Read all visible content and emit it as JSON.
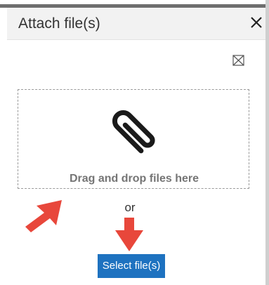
{
  "dialog": {
    "title": "Attach file(s)",
    "close_icon": "close-icon",
    "broken_image_icon": "broken-image-icon"
  },
  "drop_zone": {
    "icon": "paperclip-icon",
    "text": "Drag and drop files here"
  },
  "separator_text": "or",
  "select_button": {
    "label": "Select file(s)",
    "color": "#1e72c0"
  },
  "annotations": {
    "arrow_color": "#e8473b"
  }
}
